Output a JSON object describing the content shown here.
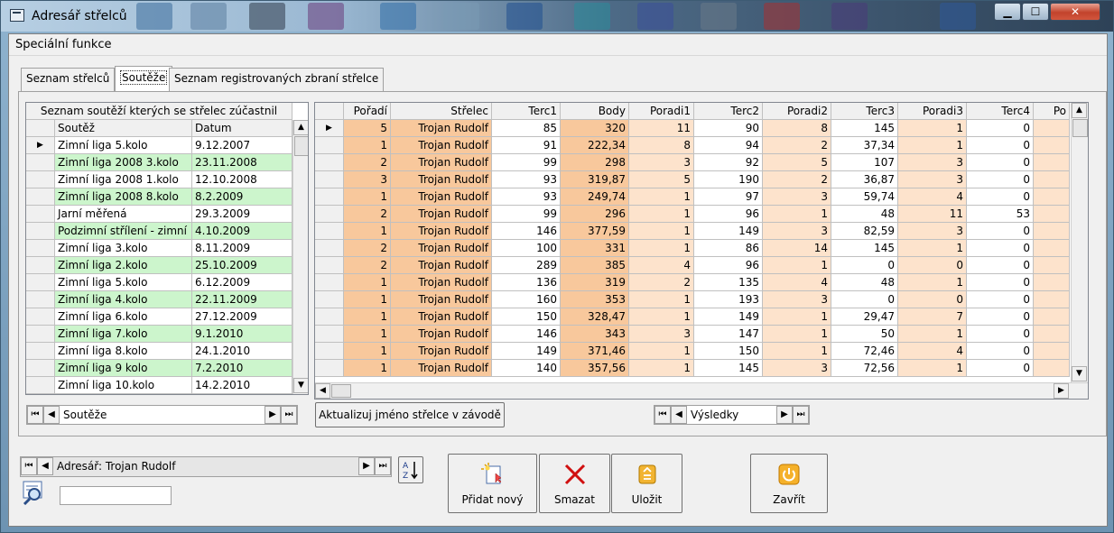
{
  "window": {
    "title": "Adresář střelců"
  },
  "menu": {
    "special": "Speciální funkce"
  },
  "tabs": [
    {
      "label": "Seznam střelců",
      "active": false
    },
    {
      "label": "Soutěže",
      "active": true
    },
    {
      "label": "Seznam registrovaných zbraní střelce",
      "active": false
    }
  ],
  "competitions": {
    "caption": "Seznam soutěží kterých se střelec zúčastnil",
    "columns": [
      "Soutěž",
      "Datum"
    ],
    "rows": [
      {
        "name": "Zimní liga 5.kolo",
        "date": "9.12.2007",
        "hl": false
      },
      {
        "name": "Zimní liga 2008 3.kolo",
        "date": "23.11.2008",
        "hl": true
      },
      {
        "name": "Zimní liga 2008 1.kolo",
        "date": "12.10.2008",
        "hl": false
      },
      {
        "name": "Zimní liga 2008 8.kolo",
        "date": "8.2.2009",
        "hl": true
      },
      {
        "name": "Jarní měřená",
        "date": "29.3.2009",
        "hl": false
      },
      {
        "name": "Podzimní střílení - zimní",
        "date": "4.10.2009",
        "hl": true
      },
      {
        "name": "Zimní liga 3.kolo",
        "date": "8.11.2009",
        "hl": false
      },
      {
        "name": "Zimní liga 2.kolo",
        "date": "25.10.2009",
        "hl": true
      },
      {
        "name": "Zimní liga 5.kolo",
        "date": "6.12.2009",
        "hl": false
      },
      {
        "name": "Zimní liga 4.kolo",
        "date": "22.11.2009",
        "hl": true
      },
      {
        "name": "Zimní liga 6.kolo",
        "date": "27.12.2009",
        "hl": false
      },
      {
        "name": "Zimní liga 7.kolo",
        "date": "9.1.2010",
        "hl": true
      },
      {
        "name": "Zimní liga 8.kolo",
        "date": "24.1.2010",
        "hl": false
      },
      {
        "name": "Zimní liga 9 kolo",
        "date": "7.2.2010",
        "hl": true
      },
      {
        "name": "Zimní liga 10.kolo",
        "date": "14.2.2010",
        "hl": false
      }
    ],
    "nav_label": "Soutěže"
  },
  "results": {
    "columns": [
      "Pořadí",
      "Střelec",
      "Terc1",
      "Body",
      "Poradi1",
      "Terc2",
      "Poradi2",
      "Terc3",
      "Poradi3",
      "Terc4",
      "Po"
    ],
    "rows": [
      [
        "5",
        "Trojan Rudolf",
        "85",
        "320",
        "11",
        "90",
        "8",
        "145",
        "1",
        "0"
      ],
      [
        "1",
        "Trojan Rudolf",
        "91",
        "222,34",
        "8",
        "94",
        "2",
        "37,34",
        "1",
        "0"
      ],
      [
        "2",
        "Trojan Rudolf",
        "99",
        "298",
        "3",
        "92",
        "5",
        "107",
        "3",
        "0"
      ],
      [
        "3",
        "Trojan Rudolf",
        "93",
        "319,87",
        "5",
        "190",
        "2",
        "36,87",
        "3",
        "0"
      ],
      [
        "1",
        "Trojan Rudolf",
        "93",
        "249,74",
        "1",
        "97",
        "3",
        "59,74",
        "4",
        "0"
      ],
      [
        "2",
        "Trojan Rudolf",
        "99",
        "296",
        "1",
        "96",
        "1",
        "48",
        "11",
        "53"
      ],
      [
        "1",
        "Trojan Rudolf",
        "146",
        "377,59",
        "1",
        "149",
        "3",
        "82,59",
        "3",
        "0"
      ],
      [
        "2",
        "Trojan Rudolf",
        "100",
        "331",
        "1",
        "86",
        "14",
        "145",
        "1",
        "0"
      ],
      [
        "2",
        "Trojan Rudolf",
        "289",
        "385",
        "4",
        "96",
        "1",
        "0",
        "0",
        "0"
      ],
      [
        "1",
        "Trojan Rudolf",
        "136",
        "319",
        "2",
        "135",
        "4",
        "48",
        "1",
        "0"
      ],
      [
        "1",
        "Trojan Rudolf",
        "160",
        "353",
        "1",
        "193",
        "3",
        "0",
        "0",
        "0"
      ],
      [
        "1",
        "Trojan Rudolf",
        "150",
        "328,47",
        "1",
        "149",
        "1",
        "29,47",
        "7",
        "0"
      ],
      [
        "1",
        "Trojan Rudolf",
        "146",
        "343",
        "3",
        "147",
        "1",
        "50",
        "1",
        "0"
      ],
      [
        "1",
        "Trojan Rudolf",
        "149",
        "371,46",
        "1",
        "150",
        "1",
        "72,46",
        "4",
        "0"
      ],
      [
        "1",
        "Trojan Rudolf",
        "140",
        "357,56",
        "1",
        "145",
        "3",
        "72,56",
        "1",
        "0"
      ]
    ],
    "nav_label": "Výsledky"
  },
  "buttons": {
    "update_name": "Aktualizuj jméno střelce v závodě",
    "add_new": "Přidat nový",
    "delete": "Smazat",
    "save": "Uložit",
    "close": "Zavřít"
  },
  "bottom": {
    "address_nav_label": "Adresář: Trojan Rudolf",
    "search_value": ""
  },
  "colors": {
    "green_row": "#ccf5cc",
    "orange_cell": "#f8c89c",
    "peach_cell": "#fde3cc"
  }
}
